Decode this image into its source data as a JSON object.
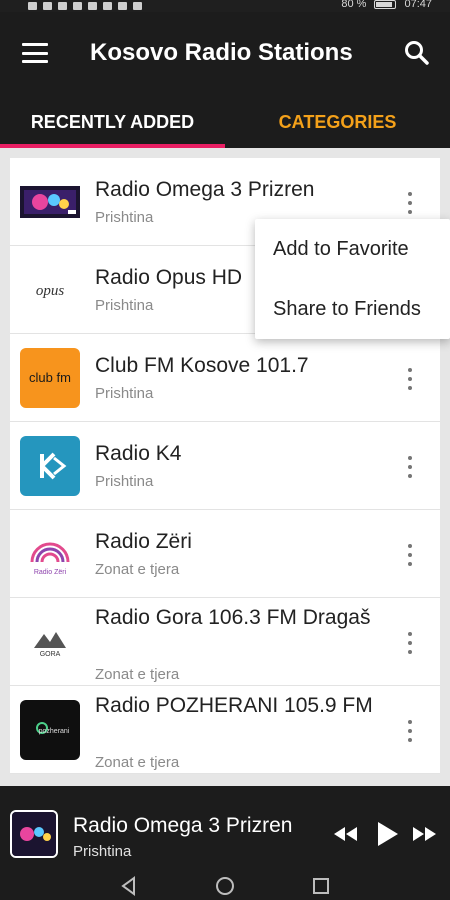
{
  "status_bar": {
    "battery_text": "80 %",
    "time": "07:47"
  },
  "app_bar": {
    "title": "Kosovo Radio Stations",
    "menu_icon": "hamburger-icon",
    "search_icon": "search-icon"
  },
  "tabs": [
    {
      "label": "RECENTLY ADDED",
      "active": true
    },
    {
      "label": "CATEGORIES",
      "active": false
    }
  ],
  "stations": [
    {
      "title": "Radio Omega 3 Prizren",
      "location": "Prishtina",
      "logo": "omega-logo"
    },
    {
      "title": "Radio Opus HD",
      "location": "Prishtina",
      "logo": "opus-logo",
      "logo_text": "opus"
    },
    {
      "title": "Club FM Kosove 101.7",
      "location": "Prishtina",
      "logo": "clubfm-logo",
      "logo_text": "club fm"
    },
    {
      "title": "Radio K4",
      "location": "Prishtina",
      "logo": "k4-logo"
    },
    {
      "title": "Radio Zëri",
      "location": "Zonat e tjera",
      "logo": "zeri-logo",
      "logo_text": "Radio Zëri"
    },
    {
      "title": "Radio Gora 106.3 FM Dragaš",
      "location": "Zonat e tjera",
      "logo": "gora-logo",
      "logo_text": "GORA"
    },
    {
      "title": "Radio POZHERANI 105.9 FM",
      "location": "Zonat e tjera",
      "logo": "pozherani-logo",
      "logo_text": "pozherani"
    }
  ],
  "context_menu": {
    "items": [
      "Add to Favorite",
      "Share to Friends"
    ]
  },
  "player": {
    "title": "Radio Omega 3 Prizren",
    "location": "Prishtina",
    "controls": [
      "rewind-icon",
      "play-icon",
      "fast-forward-icon"
    ]
  },
  "colors": {
    "accent_pink": "#e91e63",
    "accent_orange": "#f4a11a",
    "app_bar": "#1c1c1c",
    "list_bg": "#e6e6e6"
  }
}
